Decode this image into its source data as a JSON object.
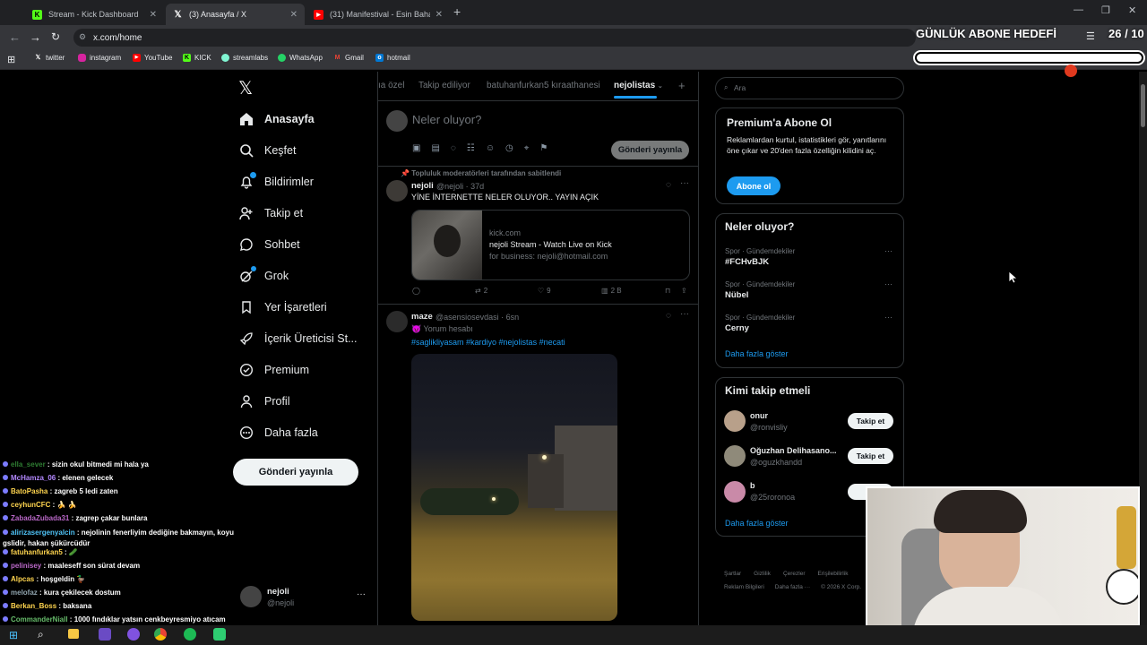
{
  "browser": {
    "tabs": [
      {
        "title": "Stream - Kick Dashboard",
        "icon": "kick-icon",
        "color": "#53fc18"
      },
      {
        "title": "(3) Anasayfa / X",
        "icon": "x-icon",
        "color": "#ffffff"
      },
      {
        "title": "(31) Manifestival - Esin Bahat İle",
        "icon": "youtube-icon",
        "color": "#ff0000"
      }
    ],
    "url": "x.com/home",
    "bookmarks": [
      "twitter",
      "instagram",
      "YouTube",
      "KICK",
      "streamlabs",
      "WhatsApp",
      "Gmail",
      "hotmail"
    ]
  },
  "overlay": {
    "goal_title": "GÜNLÜK ABONE HEDEFİ",
    "goal_count": "26 / 10",
    "goal_progress": 1.0
  },
  "nav": {
    "items": [
      "Anasayfa",
      "Keşfet",
      "Bildirimler",
      "Takip et",
      "Sohbet",
      "Grok",
      "Yer İşaretleri",
      "İçerik Üreticisi St...",
      "Premium",
      "Profil",
      "Daha fazla"
    ],
    "post_button": "Gönderi yayınla",
    "user_name": "nejoli",
    "user_handle": "@nejoli"
  },
  "timeline": {
    "tabs": [
      "ıa özel",
      "Takip ediliyor",
      "batuhanfurkan5 kıraathanesi",
      "nejolistas"
    ],
    "composer_placeholder": "Neler oluyor?",
    "composer_button": "Gönderi yayınla",
    "pinned_label": "Topluluk moderatörleri tarafından sabitlendi",
    "post1": {
      "name": "nejoli",
      "handle": "@nejoli · 37d",
      "text": "YİNE İNTERNETTE NELER OLUYOR.. YAYIN AÇIK",
      "card_domain": "kick.com",
      "card_title": "nejoli Stream - Watch Live on Kick",
      "card_desc": "for business: nejoli@hotmail.com",
      "reposts": "2",
      "likes": "9",
      "views": "2 B"
    },
    "post2": {
      "name": "maze",
      "handle": "@asensiosevdasi · 6sn",
      "sub": "😈 Yorum hesabı",
      "hashtags": "#saglikliyasam #kardiyo #nejolistas #necati"
    }
  },
  "sidebar": {
    "search_placeholder": "Ara",
    "premium_title": "Premium'a Abone Ol",
    "premium_text": "Reklamlardan kurtul, istatistikleri gör, yanıtlarını öne çıkar ve 20'den fazla özelliğin kilidini aç.",
    "premium_button": "Abone ol",
    "trends_title": "Neler oluyor?",
    "trends": [
      {
        "context": "Spor · Gündemdekiler",
        "name": "#FCHvBJK"
      },
      {
        "context": "Spor · Gündemdekiler",
        "name": "Nübel"
      },
      {
        "context": "Spor · Gündemdekiler",
        "name": "Cerny"
      }
    ],
    "show_more": "Daha fazla göster",
    "who_title": "Kimi takip etmeli",
    "who": [
      {
        "name": "onur",
        "handle": "@ronvisliy",
        "button": "Takip et"
      },
      {
        "name": "Oğuzhan Delihasano...",
        "handle": "@oguzkhandd",
        "button": "Takip et"
      },
      {
        "name": "b",
        "handle": "@25roronoa",
        "button": "Ta"
      }
    ],
    "footer_row1": [
      "Şartlar",
      "Gizlilik",
      "Çerezler",
      "Erişilebilirlik"
    ],
    "footer_row2": [
      "Reklam Bilgileri",
      "Daha fazla ···",
      "© 2026 X Corp."
    ]
  },
  "chat": [
    {
      "user": "ella_sever",
      "msg": "sizin okul bitmedi mi hala ya",
      "color": "#2e7d32"
    },
    {
      "user": "McHamza_06",
      "msg": "elenen gelecek",
      "color": "#b388ff"
    },
    {
      "user": "BatoPasha",
      "msg": "zagreb 5 ledi zaten",
      "color": "#ffd54f"
    },
    {
      "user": "ceyhunCFC",
      "msg": "🍌 🍌",
      "color": "#ffd54f"
    },
    {
      "user": "ZabadaZubada31",
      "msg": "zagrep çakar bunlara",
      "color": "#ba68c8"
    },
    {
      "user": "alirizasergenyalcin",
      "msg": "nejolinin fenerliyim dediğine bakmayın, koyu gslidir, hakan şükürcüdür",
      "color": "#4fc3f7"
    },
    {
      "user": "fatuhanfurkan5",
      "msg": "🥒",
      "color": "#ffd54f"
    },
    {
      "user": "pelinisey",
      "msg": "maaleseff son sürat devam",
      "color": "#ba68c8"
    },
    {
      "user": "Alpcas",
      "msg": "hoşgeldin 🦆",
      "color": "#ffd54f"
    },
    {
      "user": "melofaz",
      "msg": "kura çekilecek dostum",
      "color": "#90a4ae"
    },
    {
      "user": "Berkan_Boss",
      "msg": "baksana",
      "color": "#ffd54f"
    },
    {
      "user": "CommanderNiall",
      "msg": "1000 fındıklar yatsın cenkbeyresmiyo atıcam",
      "color": "#66bb6a"
    }
  ]
}
